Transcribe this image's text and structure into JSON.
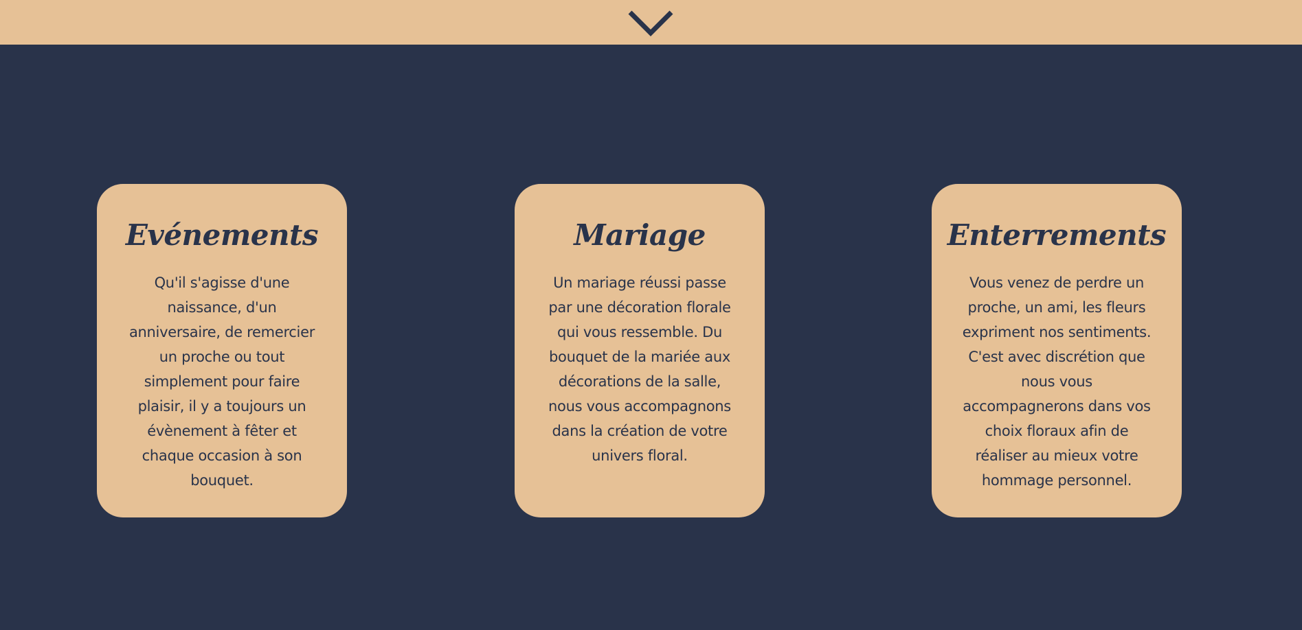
{
  "header": {
    "scroll_icon": "chevron-down-icon"
  },
  "colors": {
    "page_background": "#29334a",
    "accent": "#e6c196"
  },
  "cards": [
    {
      "title": "Evénements",
      "lines": [
        "Qu'il s'agisse d'une",
        "naissance, d'un",
        "anniversaire, de remercier",
        "un proche ou tout",
        "simplement pour faire",
        "plaisir, il y a toujours un",
        "évènement à fêter et",
        "chaque occasion à son",
        "bouquet."
      ]
    },
    {
      "title": "Mariage",
      "lines": [
        "Un mariage réussi passe",
        "par une décoration florale",
        "qui vous ressemble. Du",
        "bouquet de la mariée aux",
        "décorations de la salle,",
        "nous vous accompagnons",
        "dans la création de votre",
        "univers floral."
      ]
    },
    {
      "title": "Enterrements",
      "lines": [
        "Vous venez de perdre un",
        "proche, un ami, les fleurs",
        "expriment nos sentiments.",
        "C'est avec discrétion que",
        "nous vous",
        "accompagnerons dans vos",
        "choix floraux afin de",
        "réaliser au mieux votre",
        "hommage personnel."
      ]
    }
  ]
}
